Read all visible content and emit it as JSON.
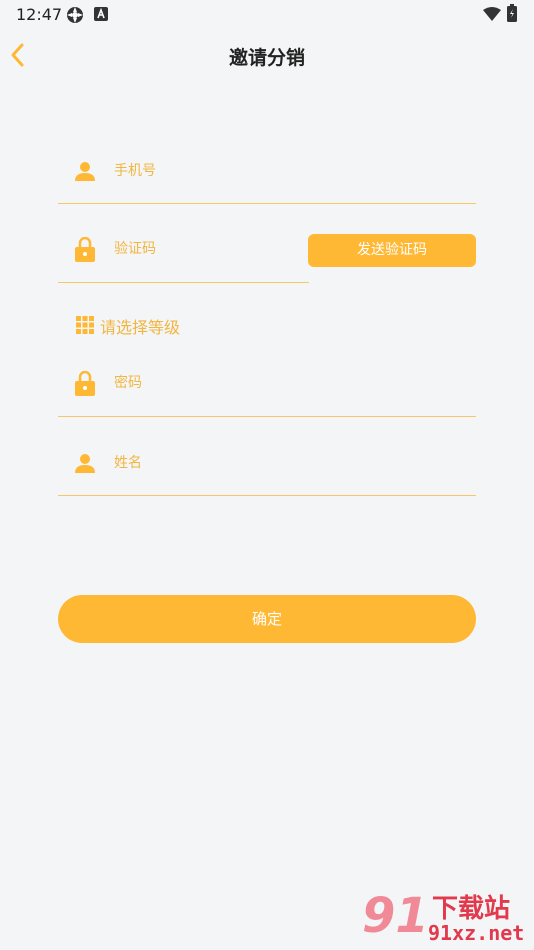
{
  "status_bar": {
    "time": "12:47"
  },
  "header": {
    "title": "邀请分销"
  },
  "form": {
    "phone_placeholder": "手机号",
    "code_placeholder": "验证码",
    "send_code_label": "发送验证码",
    "level_label": "请选择等级",
    "password_placeholder": "密码",
    "name_placeholder": "姓名",
    "confirm_label": "确定"
  },
  "watermark": {
    "logo": "91",
    "brand": "下载站",
    "domain": "91xz.net"
  },
  "colors": {
    "accent": "#ffb834",
    "placeholder": "#f2b640",
    "underline": "#f6c66a",
    "background": "#f4f5f7"
  },
  "icons": [
    "user-icon",
    "lock-icon",
    "grid-icon",
    "back-arrow-icon",
    "wifi-icon",
    "battery-icon"
  ]
}
